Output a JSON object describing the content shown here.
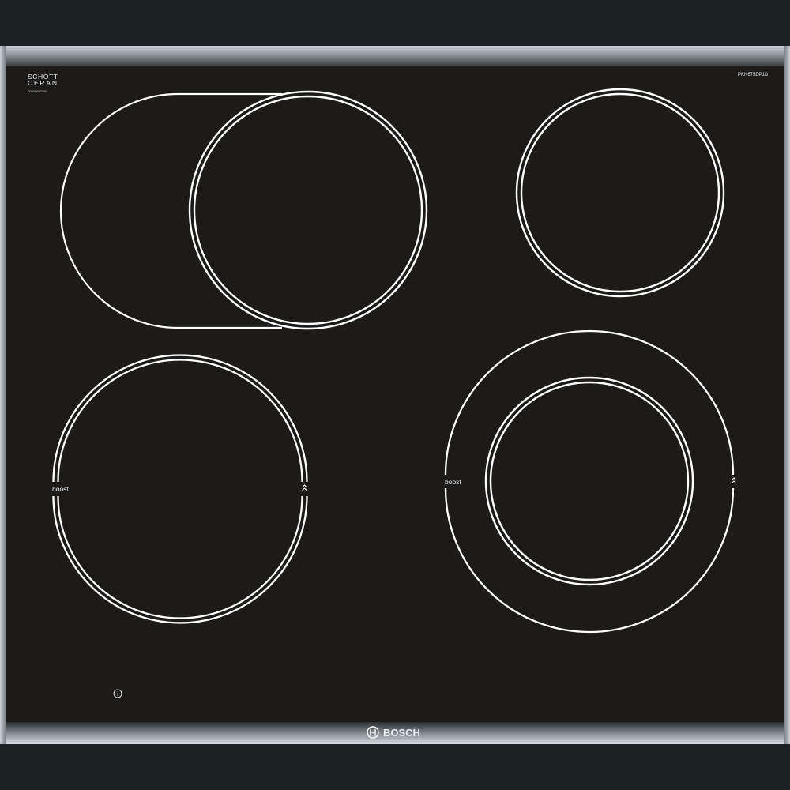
{
  "scene": {
    "manufacturer": "BOSCH",
    "glass_brand": {
      "line1": "SCHOTT",
      "line2": "CERAN",
      "serial": "00000007000"
    },
    "model_code": "PKN675DP1D",
    "zones": [
      {
        "label": "boost"
      },
      {
        "label": "boost"
      }
    ],
    "info_symbol": "i",
    "colors": {
      "glass": "#1c1b19",
      "zone_lines": "#ffffff",
      "steel_frame": "#8f979c",
      "backdrop": "#1b2022"
    }
  }
}
